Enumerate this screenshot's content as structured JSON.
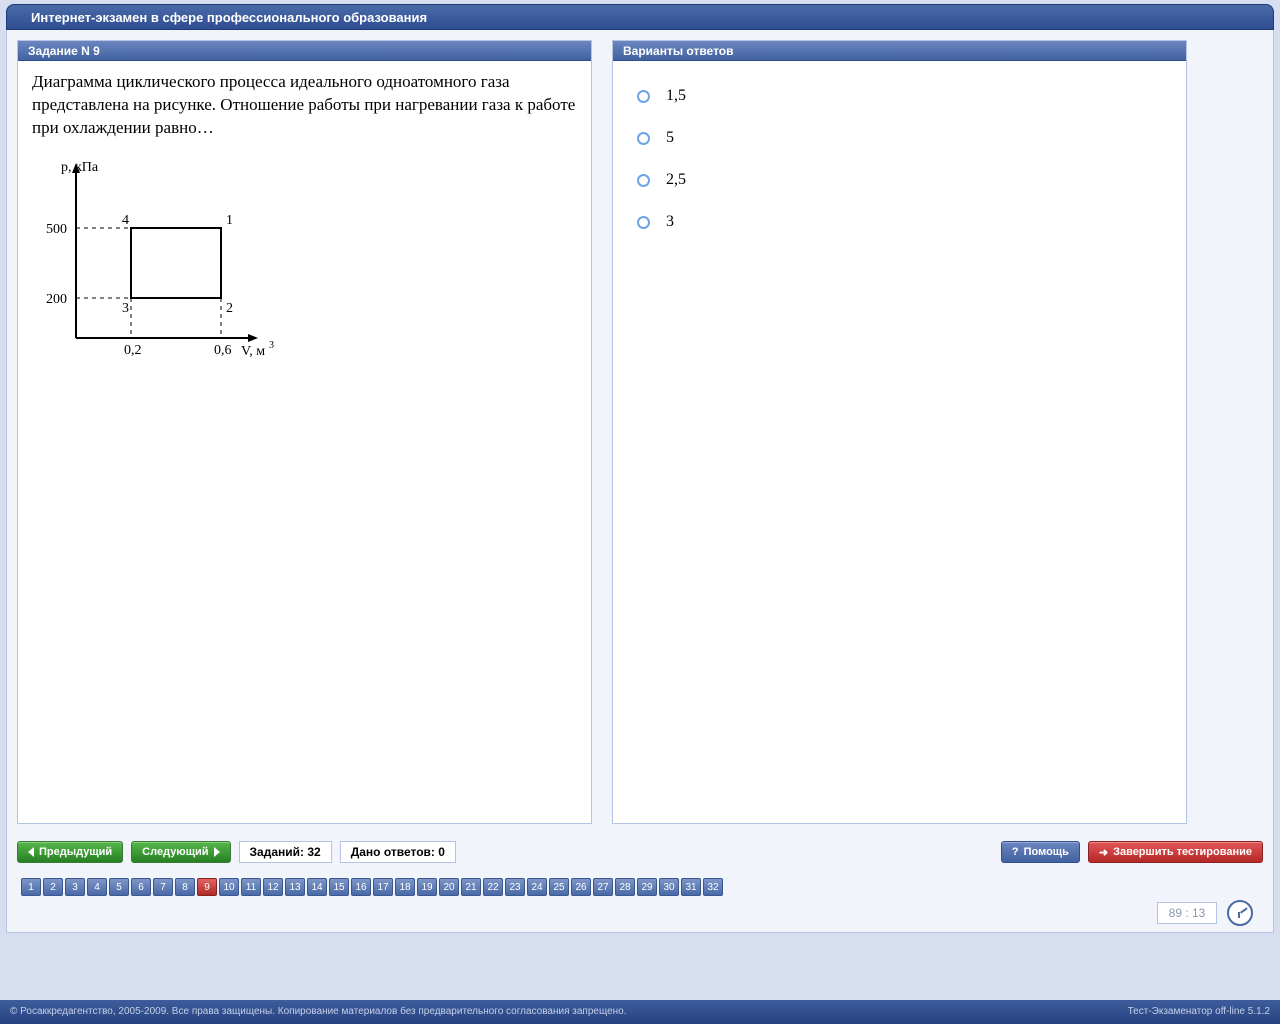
{
  "app_title": "Интернет-экзамен в сфере профессионального образования",
  "task_header": "Задание N 9",
  "answers_header": "Варианты ответов",
  "question_text": "Диаграмма циклического процесса идеального одноатомного газа представлена на рисунке. Отношение работы при нагревании газа к работе при охлаждении равно…",
  "answers": [
    "1,5",
    "5",
    "2,5",
    "3"
  ],
  "toolbar": {
    "prev": "Предыдущий",
    "next": "Следующий",
    "total_label": "Заданий:",
    "total_value": "32",
    "answered_label": "Дано ответов:",
    "answered_value": "0",
    "help": "Помощь",
    "finish": "Завершить тестирование"
  },
  "nav": {
    "items": [
      "1",
      "2",
      "3",
      "4",
      "5",
      "6",
      "7",
      "8",
      "9",
      "10",
      "11",
      "12",
      "13",
      "14",
      "15",
      "16",
      "17",
      "18",
      "19",
      "20",
      "21",
      "22",
      "23",
      "24",
      "25",
      "26",
      "27",
      "28",
      "29",
      "30",
      "31",
      "32"
    ],
    "active_index": 8
  },
  "timer": "89 : 13",
  "footer": {
    "left": "© Росаккредагентство, 2005-2009. Все права защищены. Копирование материалов без предварительного согласования запрещено.",
    "right": "Тест-Экзаменатор off-line 5.1.2"
  },
  "diagram": {
    "y_axis_label": "p, кПа",
    "x_axis_label": "V, м",
    "x_axis_unit_sup": "3",
    "y_ticks": [
      "500",
      "200"
    ],
    "x_ticks": [
      "0,2",
      "0,6"
    ],
    "points": [
      "1",
      "2",
      "3",
      "4"
    ]
  },
  "chart_data": {
    "type": "line",
    "title": "",
    "xlabel": "V, м³",
    "ylabel": "p, кПа",
    "x": [
      0.2,
      0.6,
      0.6,
      0.2,
      0.2
    ],
    "values": [
      500,
      500,
      200,
      200,
      500
    ],
    "point_labels": [
      "4",
      "1",
      "2",
      "3",
      "4"
    ],
    "xlim": [
      0,
      0.8
    ],
    "ylim": [
      0,
      600
    ],
    "x_ticks": [
      0.2,
      0.6
    ],
    "y_ticks": [
      200,
      500
    ]
  }
}
